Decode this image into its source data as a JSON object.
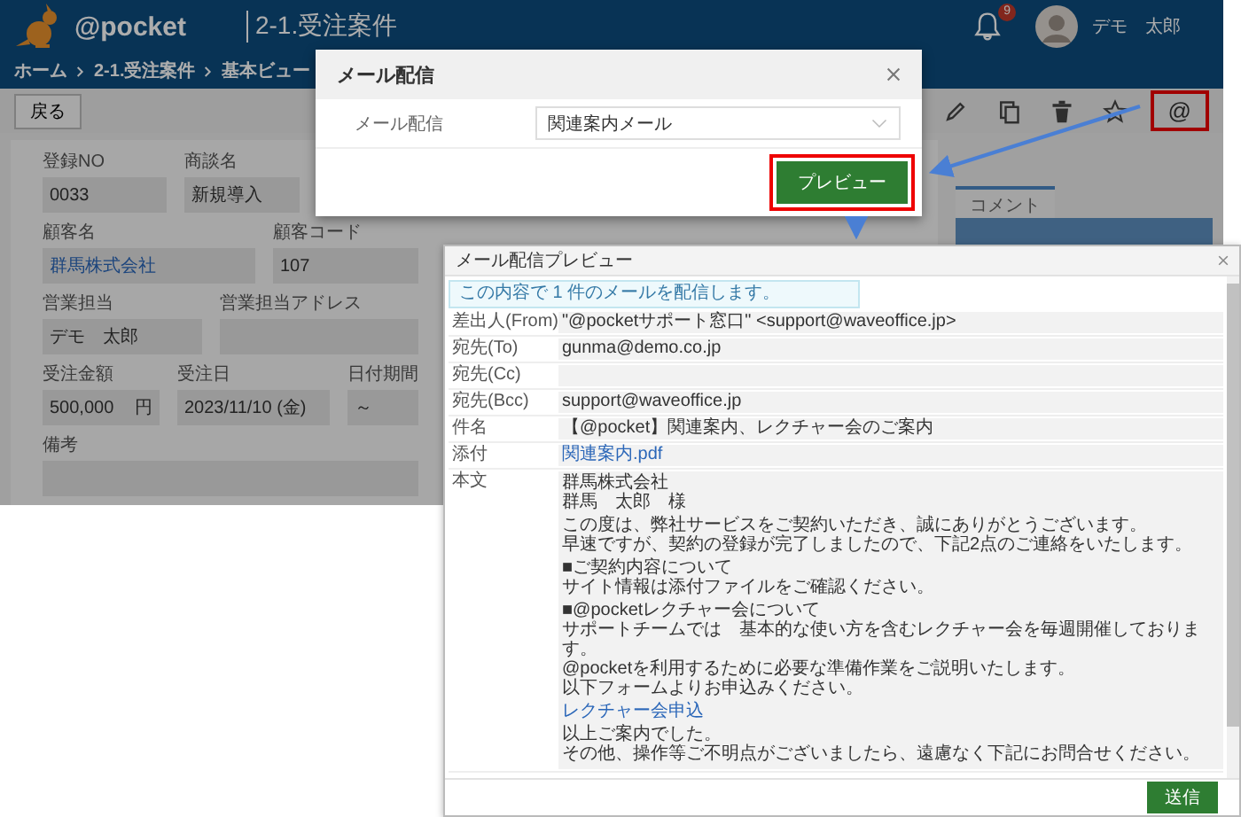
{
  "app": {
    "logo": "@pocket",
    "title": "2-1.受注案件",
    "notification_count": "9",
    "user": "デモ　太郎",
    "breadcrumb": [
      "ホーム",
      "2-1.受注案件",
      "基本ビュー"
    ],
    "back_button": "戻る",
    "mail_button": {
      "icon": "@",
      "highlighted": true
    },
    "tabs": [
      {
        "label": "コメント",
        "selected": true
      }
    ],
    "form_rows": [
      {
        "fields": [
          {
            "label": "登録NO",
            "value": "0033",
            "kind": "text"
          },
          {
            "label": "商談名",
            "value": "新規導入",
            "kind": "text"
          }
        ]
      },
      {
        "fields": [
          {
            "label": "顧客名",
            "value": "群馬株式会社",
            "kind": "link"
          },
          {
            "label": "顧客コード",
            "value": "107",
            "kind": "text"
          }
        ]
      },
      {
        "fields": [
          {
            "label": "営業担当",
            "value": "デモ　太郎",
            "kind": "text"
          },
          {
            "label": "営業担当アドレス",
            "kind": "empty"
          }
        ]
      },
      {
        "fields": [
          {
            "label": "受注金額",
            "value": "500,000",
            "unit": "円",
            "kind": "text"
          },
          {
            "label": "受注日",
            "value": "2023/11/10 (金)",
            "kind": "text"
          },
          {
            "label": "日付期間",
            "value": "～",
            "kind": "text"
          }
        ]
      },
      {
        "fields": [
          {
            "label": "備考",
            "kind": "empty"
          }
        ]
      }
    ]
  },
  "modal": {
    "title": "メール配信",
    "field_label": "メール配信",
    "select_value": "関連案内メール",
    "preview_button": {
      "label": "プレビュー",
      "highlighted": true
    }
  },
  "preview": {
    "title": "メール配信プレビュー",
    "notice": "この内容で 1 件のメールを配信します。",
    "fields": [
      {
        "label": "差出人(From)",
        "value": "\"@pocketサポート窓口\" <support@waveoffice.jp>",
        "kind": "text"
      },
      {
        "label": "宛先(To)",
        "value": "gunma@demo.co.jp",
        "kind": "text"
      },
      {
        "label": "宛先(Cc)",
        "kind": "empty"
      },
      {
        "label": "宛先(Bcc)",
        "value": "support@waveoffice.jp",
        "kind": "text"
      },
      {
        "label": "件名",
        "value": "【@pocket】関連案内、レクチャー会のご案内",
        "kind": "text"
      },
      {
        "label": "添付",
        "value": "関連案内.pdf",
        "kind": "link"
      }
    ],
    "body_label": "本文",
    "body": [
      {
        "kind": "text",
        "lines": [
          "群馬株式会社",
          "群馬　太郎　様"
        ]
      },
      {
        "kind": "text",
        "lines": [
          "この度は、弊社サービスをご契約いただき、誠にありがとうございます。",
          "早速ですが、契約の登録が完了しましたので、下記2点のご連絡をいたします。"
        ]
      },
      {
        "kind": "text",
        "lines": [
          "■ご契約内容について",
          "サイト情報は添付ファイルをご確認ください。"
        ]
      },
      {
        "kind": "text",
        "lines": [
          "■@pocketレクチャー会について",
          "サポートチームでは　基本的な使い方を含むレクチャー会を毎週開催しております。",
          "@pocketを利用するために必要な準備作業をご説明いたします。",
          "以下フォームよりお申込みください。"
        ]
      },
      {
        "kind": "link",
        "lines": [
          "レクチャー会申込"
        ]
      },
      {
        "kind": "text",
        "lines": [
          "以上ご案内でした。",
          "その他、操作等ご不明点がございましたら、遠慮なく下記にお問合せください。"
        ]
      }
    ],
    "send_button": "送信"
  }
}
